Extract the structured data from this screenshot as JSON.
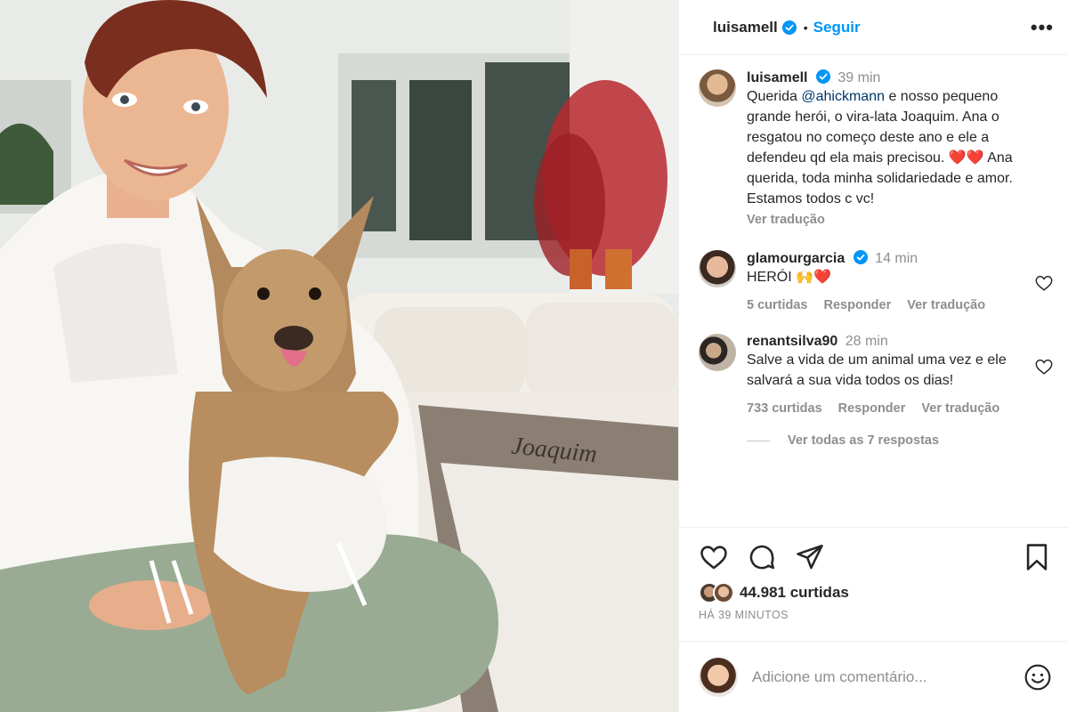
{
  "post": {
    "username": "luisamell",
    "follow_label": "Seguir",
    "more_label": "•••",
    "dot": "•"
  },
  "photo": {
    "bed_text": "Joaquim"
  },
  "caption": {
    "username": "luisamell",
    "time": "39 min",
    "text_before": "Querida ",
    "mention": "@ahickmann",
    "text_after": " e nosso pequeno grande herói, o vira-lata Joaquim. Ana o resgatou no começo deste ano e ele a defendeu qd ela mais precisou. ❤️❤️ Ana querida, toda minha solidariedade e amor. Estamos todos c vc!",
    "translate": "Ver tradução"
  },
  "comments": [
    {
      "username": "glamourgarcia",
      "verified": true,
      "time": "14 min",
      "text": "HERÓI 🙌❤️",
      "likes": "5 curtidas",
      "reply": "Responder",
      "translate": "Ver tradução"
    },
    {
      "username": "renantsilva90",
      "verified": false,
      "time": "28 min",
      "text": "Salve a vida de um animal uma vez e ele salvará a sua vida todos os dias!",
      "likes": "733 curtidas",
      "reply": "Responder",
      "translate": "Ver tradução",
      "view_replies": "Ver todas as 7 respostas"
    }
  ],
  "footer": {
    "likes_count": "44.981 curtidas",
    "timestamp": "HÁ 39 MINUTOS",
    "comment_placeholder": "Adicione um comentário..."
  },
  "colors": {
    "accent": "#0095f6",
    "verified": "#0095f6",
    "muted": "#8e8e8e",
    "text": "#262626",
    "mention": "#00376b"
  },
  "icons": [
    "verified-icon",
    "more-icon",
    "heart-icon",
    "comment-icon",
    "share-icon",
    "bookmark-icon",
    "emoji-icon"
  ]
}
